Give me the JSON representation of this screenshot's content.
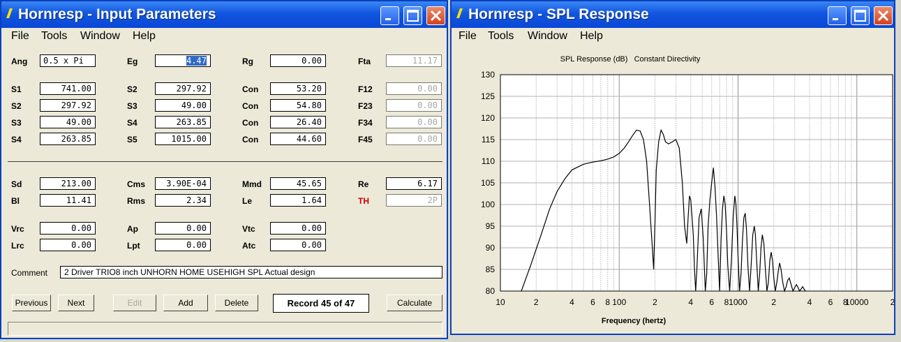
{
  "input_window": {
    "title": "Hornresp - Input Parameters",
    "menu": [
      "File",
      "Tools",
      "Window",
      "Help"
    ],
    "params": [
      {
        "label": "Ang",
        "value": "0.5 x Pi"
      },
      {
        "label": "Eg",
        "value": "4.47"
      },
      {
        "label": "Rg",
        "value": "0.00"
      },
      {
        "label": "Fta",
        "value": "11.17"
      },
      {
        "label": "S1",
        "value": "741.00"
      },
      {
        "label": "S2",
        "value": "297.92"
      },
      {
        "label": "Con",
        "value": "53.20"
      },
      {
        "label": "F12",
        "value": "0.00"
      },
      {
        "label": "S2",
        "value": "297.92"
      },
      {
        "label": "S3",
        "value": "49.00"
      },
      {
        "label": "Con",
        "value": "54.80"
      },
      {
        "label": "F23",
        "value": "0.00"
      },
      {
        "label": "S3",
        "value": "49.00"
      },
      {
        "label": "S4",
        "value": "263.85"
      },
      {
        "label": "Con",
        "value": "26.40"
      },
      {
        "label": "F34",
        "value": "0.00"
      },
      {
        "label": "S4",
        "value": "263.85"
      },
      {
        "label": "S5",
        "value": "1015.00"
      },
      {
        "label": "Con",
        "value": "44.60"
      },
      {
        "label": "F45",
        "value": "0.00"
      },
      {
        "label": "Sd",
        "value": "213.00"
      },
      {
        "label": "Cms",
        "value": "3.90E-04"
      },
      {
        "label": "Mmd",
        "value": "45.65"
      },
      {
        "label": "Re",
        "value": "6.17"
      },
      {
        "label": "Bl",
        "value": "11.41"
      },
      {
        "label": "Rms",
        "value": "2.34"
      },
      {
        "label": "Le",
        "value": "1.64"
      },
      {
        "label": "TH",
        "value": "2P"
      },
      {
        "label": "Vrc",
        "value": "0.00"
      },
      {
        "label": "Ap",
        "value": "0.00"
      },
      {
        "label": "Vtc",
        "value": "0.00"
      },
      {
        "label": "Lrc",
        "value": "0.00"
      },
      {
        "label": "Lpt",
        "value": "0.00"
      },
      {
        "label": "Atc",
        "value": "0.00"
      }
    ],
    "comment_label": "Comment",
    "comment": "2 Driver TRIO8 inch UNHORN HOME USEHIGH SPL Actual design",
    "buttons": {
      "previous": "Previous",
      "next": "Next",
      "edit": "Edit",
      "add": "Add",
      "delete": "Delete",
      "calculate": "Calculate"
    },
    "record": "Record 45 of 47",
    "colors": {
      "title_bar": "#0a48d6",
      "selection": "#316ac5",
      "th_label": "#cc0000"
    }
  },
  "spl_window": {
    "title": "Hornresp - SPL Response",
    "menu": [
      "File",
      "Tools",
      "Window",
      "Help"
    ],
    "chart_data": {
      "type": "line",
      "title": "SPL Response (dB)   Constant Directivity",
      "xlabel": "Frequency (hertz)",
      "ylabel": "",
      "x_scale": "log",
      "xlim": [
        10,
        20000
      ],
      "ylim": [
        80,
        130
      ],
      "y_ticks": [
        80,
        85,
        90,
        95,
        100,
        105,
        110,
        115,
        120,
        125,
        130
      ],
      "x_tick_labels": [
        "10",
        "2",
        "4",
        "6",
        "8",
        "100",
        "2",
        "4",
        "6",
        "8",
        "1000",
        "2",
        "4",
        "6",
        "8",
        "10000",
        "2"
      ],
      "grid": true,
      "series": [
        {
          "x": [
            15,
            18,
            22,
            26,
            30,
            35,
            40,
            50,
            60,
            70,
            80,
            90,
            100,
            110,
            120,
            130,
            140,
            150,
            160,
            170,
            180,
            190,
            195,
            200,
            205,
            215,
            225,
            235,
            245,
            260,
            280,
            300,
            320,
            340,
            355,
            370,
            380,
            390,
            400,
            420,
            430,
            440,
            450,
            470,
            490,
            510,
            530,
            545,
            560,
            580,
            600,
            620,
            640,
            660,
            680,
            700,
            720,
            740,
            760,
            780,
            800,
            820,
            850,
            880,
            910,
            940,
            960,
            980,
            1000,
            1030,
            1060,
            1090,
            1120,
            1150,
            1180,
            1210,
            1250,
            1290,
            1330,
            1370,
            1400,
            1440,
            1480,
            1520,
            1560,
            1600,
            1650,
            1700,
            1750,
            1800,
            1850,
            1900,
            1950,
            2000,
            2060,
            2120,
            2180,
            2240,
            2300,
            2380,
            2460,
            2540,
            2620,
            2700,
            2800,
            2900,
            3000,
            3100,
            3200,
            3300,
            3400,
            3500,
            3600,
            3700
          ],
          "y": [
            80,
            86,
            93,
            99,
            103,
            106,
            108,
            109.3,
            109.8,
            110.1,
            110.5,
            111,
            111.8,
            113,
            114.5,
            116,
            117.2,
            117,
            115,
            110,
            100,
            90,
            85,
            96,
            108,
            114.5,
            117.2,
            116.2,
            114.5,
            114,
            114.5,
            115,
            113,
            105,
            95,
            91,
            97,
            102,
            101,
            93,
            85,
            80,
            85,
            97,
            99,
            92,
            80,
            84,
            95,
            101,
            105,
            108.5,
            104,
            97,
            88,
            80,
            92,
            99,
            102,
            100,
            94,
            86,
            80,
            87,
            97,
            102,
            100,
            95,
            88,
            80,
            84,
            92,
            97,
            98,
            94,
            86,
            80,
            86,
            93,
            95,
            93,
            86,
            80,
            84,
            90,
            93,
            91,
            85,
            80,
            82,
            87,
            89,
            87,
            83,
            80,
            82,
            84.5,
            86.5,
            85,
            82,
            80,
            81,
            82.5,
            83,
            81.5,
            80,
            80.8,
            81.5,
            80.8,
            80,
            80.5,
            81,
            80.4,
            80
          ]
        }
      ]
    },
    "colors": {
      "line": "#000000",
      "grid": "#b0b0b0"
    }
  }
}
